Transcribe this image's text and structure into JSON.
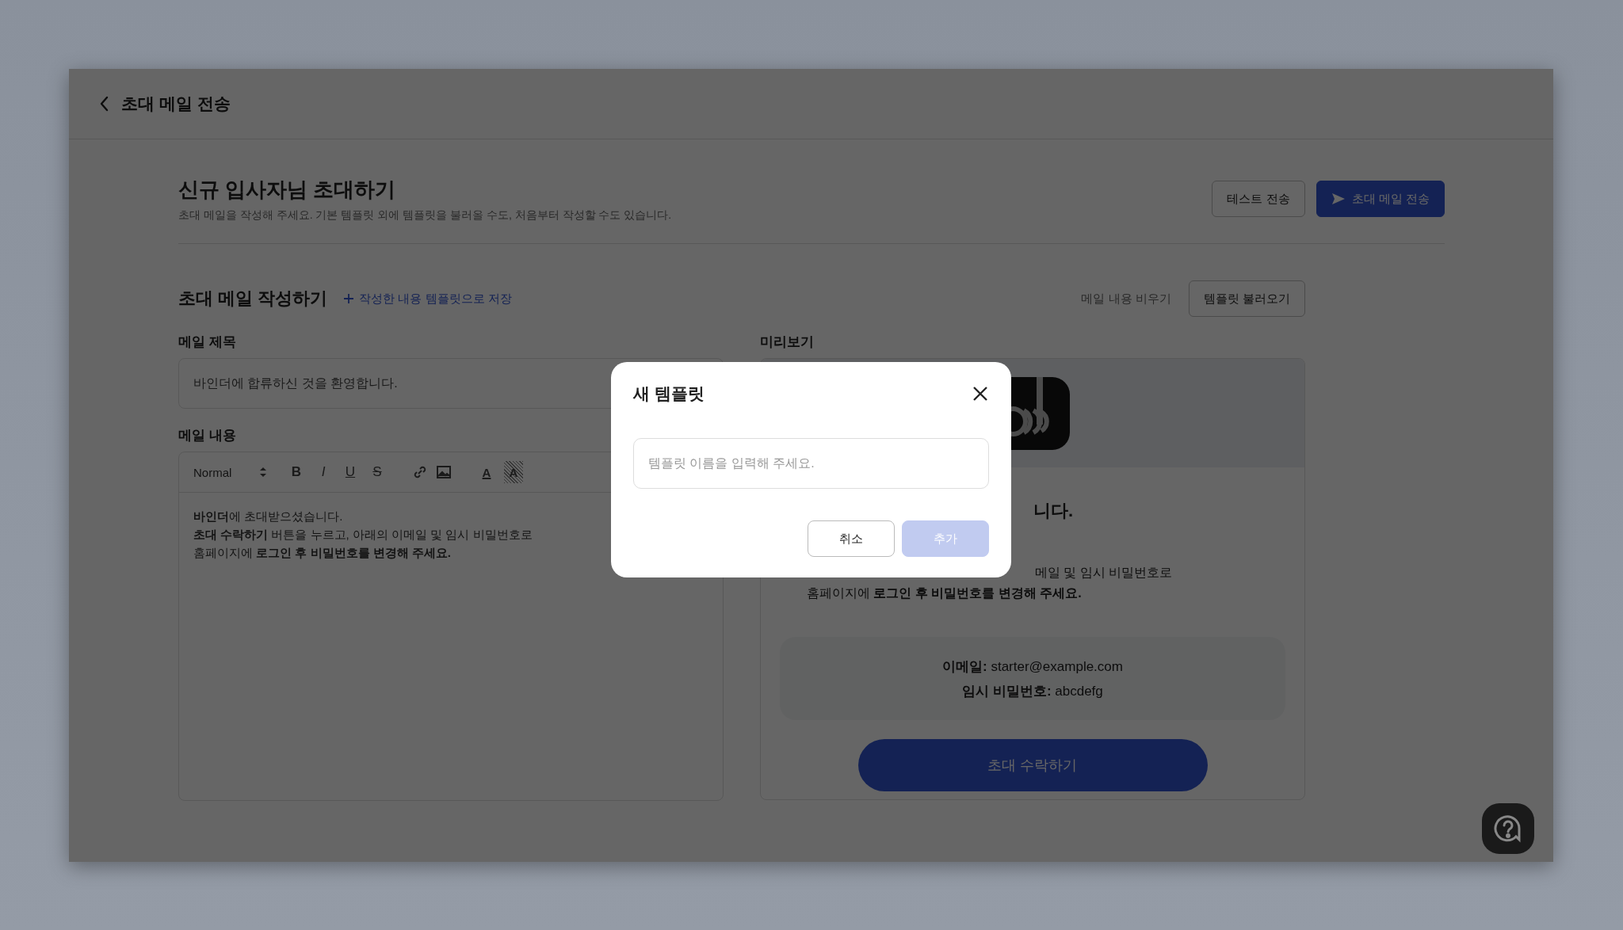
{
  "header": {
    "title": "초대 메일 전송"
  },
  "page": {
    "title": "신규 입사자님 초대하기",
    "subtitle": "초대 메일을 작성해 주세요. 기본 템플릿 외에 템플릿을 불러올 수도, 처음부터 작성할 수도 있습니다.",
    "buttons": [
      {
        "label": "테스트 전송",
        "kind": "secondary"
      },
      {
        "label": "초대 메일 전송",
        "kind": "primary"
      }
    ]
  },
  "compose": {
    "title": "초대 메일 작성하기",
    "save_link": "작성한 내용 템플릿으로 저장",
    "clear_link": "메일 내용 비우기",
    "load_button": "템플릿 불러오기"
  },
  "subject": {
    "label": "메일 제목",
    "value": "바인더에 합류하신 것을 환영합니다."
  },
  "body": {
    "label": "메일 내용",
    "format": "Normal",
    "toolbar": [
      {
        "kind": "bold",
        "label": "B"
      },
      {
        "kind": "italic",
        "label": "I"
      },
      {
        "kind": "underline",
        "label": "U"
      },
      {
        "kind": "strike",
        "label": "S"
      },
      {
        "kind": "link"
      },
      {
        "kind": "image"
      },
      {
        "kind": "color",
        "label": "A"
      },
      {
        "kind": "highlight",
        "label": "A"
      }
    ],
    "lines": [
      "**바인더**에 초대받으셨습니다.",
      "**초대 수락하기** 버튼을 누르고, 아래의 이메일 및 임시 비밀번호로",
      "홈페이지에 **로그인 후 비밀번호를 변경해 주세요.**"
    ]
  },
  "preview": {
    "label": "미리보기",
    "heading_fragment": "니다.",
    "line_fragment": "메일 및 임시 비밀번호로",
    "lines": [
      "홈페이지에 **로그인 후 비밀번호를 변경해 주세요.**"
    ],
    "info": [
      "**이메일:** starter@example.com",
      "**임시 비밀번호:** abcdefg"
    ],
    "accept_button": "초대 수락하기"
  },
  "modal": {
    "title": "새 템플릿",
    "placeholder": "템플릿 이름을 입력해 주세요.",
    "buttons": [
      {
        "label": "취소",
        "kind": "secondary",
        "disabled": false
      },
      {
        "label": "추가",
        "kind": "primary",
        "disabled": true
      }
    ]
  }
}
